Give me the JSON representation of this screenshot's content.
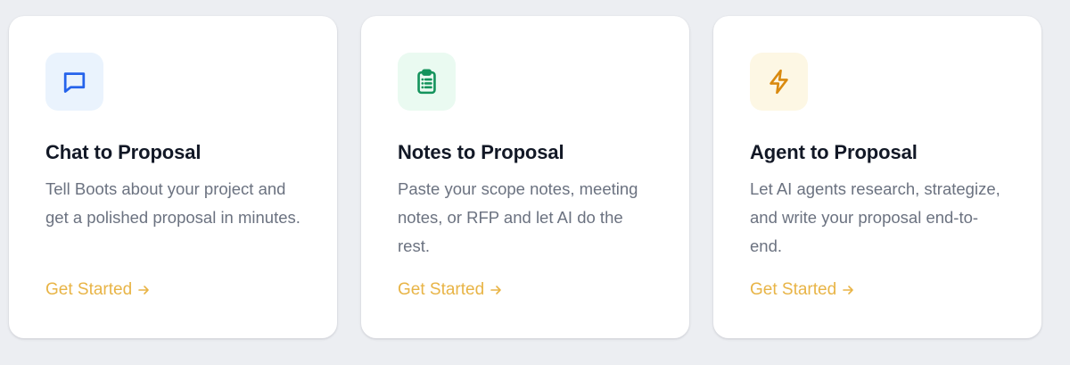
{
  "colors": {
    "page_bg": "#eceef2",
    "card_bg": "#ffffff",
    "accent": "#e8b446",
    "title": "#121826",
    "body_text": "#6b7280"
  },
  "cards": [
    {
      "icon": "chat-bubble-icon",
      "icon_color": "#2563eb",
      "icon_bg": "#eaf3fd",
      "title": "Chat to Proposal",
      "description": "Tell Boots about your project and get a polished proposal in minutes.",
      "cta": "Get Started"
    },
    {
      "icon": "clipboard-list-icon",
      "icon_color": "#14935c",
      "icon_bg": "#eafaf1",
      "title": "Notes to Proposal",
      "description": "Paste your scope notes, meeting notes, or RFP and let AI do the rest.",
      "cta": "Get Started"
    },
    {
      "icon": "lightning-bolt-icon",
      "icon_color": "#d98a0f",
      "icon_bg": "#fdf7e4",
      "title": "Agent to Proposal",
      "description": "Let AI agents research, strategize, and write your proposal end-to-end.",
      "cta": "Get Started"
    }
  ]
}
